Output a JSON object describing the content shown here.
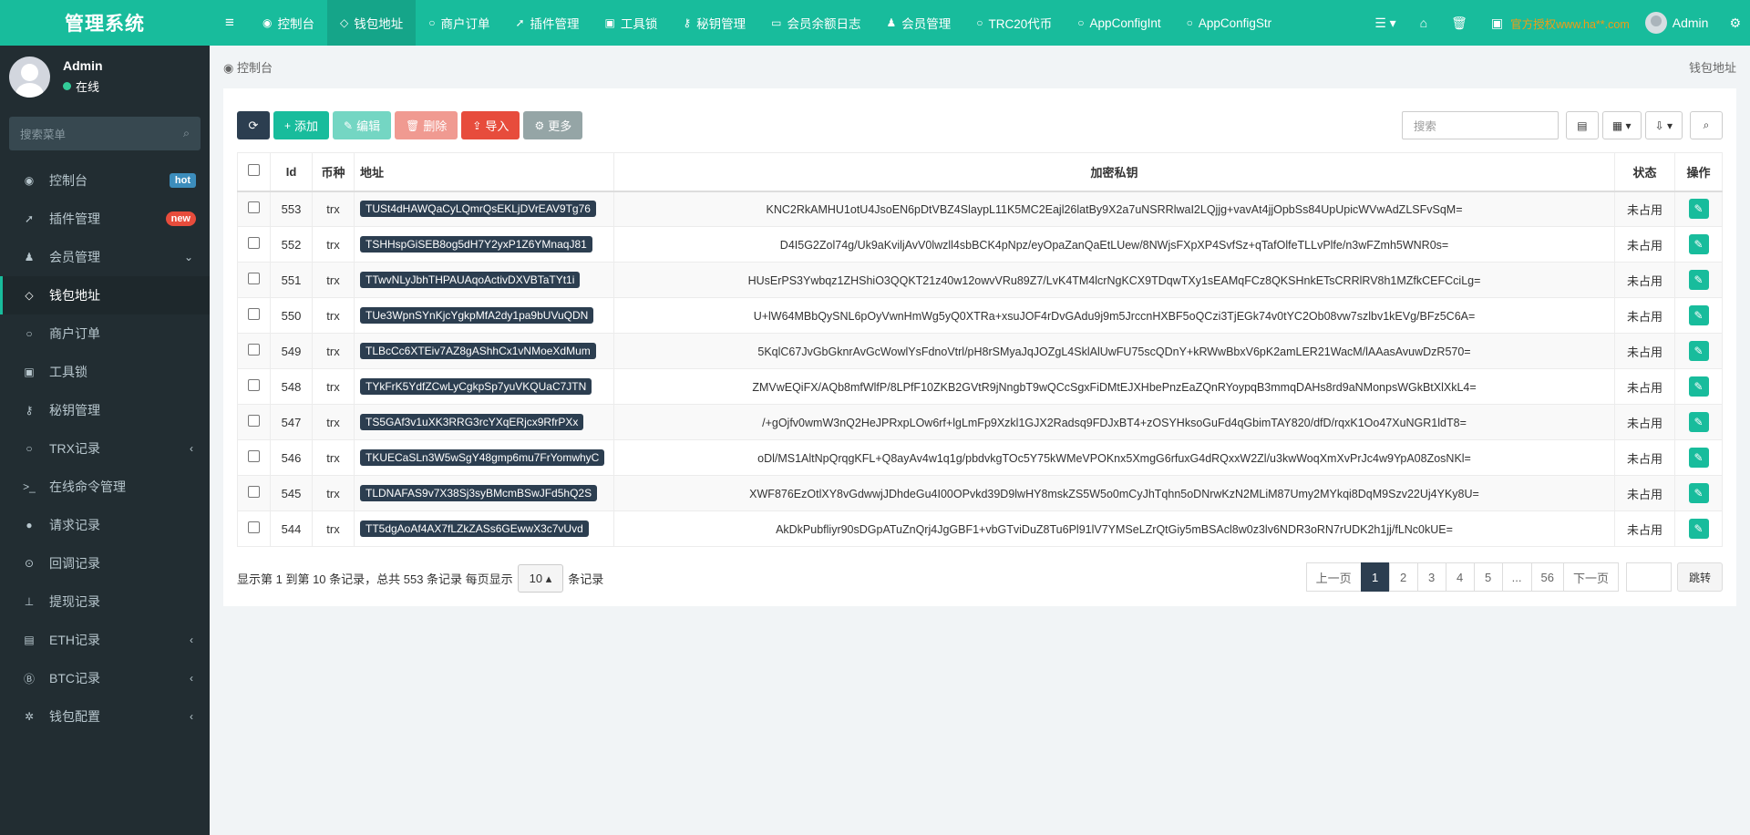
{
  "app": {
    "title": "管理系统"
  },
  "topnav": {
    "tabs": [
      {
        "icon": "dashboard-icon",
        "glyph": "◉",
        "label": "控制台"
      },
      {
        "icon": "diamond-icon",
        "glyph": "◇",
        "label": "钱包地址"
      },
      {
        "icon": "circle-icon",
        "glyph": "○",
        "label": "商户订单"
      },
      {
        "icon": "rocket-icon",
        "glyph": "➚",
        "label": "插件管理"
      },
      {
        "icon": "lock-icon",
        "glyph": "▣",
        "label": "工具锁"
      },
      {
        "icon": "key-icon",
        "glyph": "⚷",
        "label": "秘钥管理"
      },
      {
        "icon": "money-icon",
        "glyph": "▭",
        "label": "会员余额日志"
      },
      {
        "icon": "user-icon",
        "glyph": "♟",
        "label": "会员管理"
      },
      {
        "icon": "circle-icon",
        "glyph": "○",
        "label": "TRC20代币"
      },
      {
        "icon": "circle-icon",
        "glyph": "○",
        "label": "AppConfigInt"
      },
      {
        "icon": "circle-icon",
        "glyph": "○",
        "label": "AppConfigStr"
      }
    ],
    "right": {
      "promo": "官方授权www.ha**.com",
      "user": "Admin"
    }
  },
  "sidebar": {
    "user": {
      "name": "Admin",
      "status": "在线"
    },
    "search_placeholder": "搜索菜单",
    "items": [
      {
        "label": "控制台",
        "glyph": "◉",
        "badge": "hot"
      },
      {
        "label": "插件管理",
        "glyph": "➚",
        "badge": "new"
      },
      {
        "label": "会员管理",
        "glyph": "♟",
        "arrow": "⌄"
      },
      {
        "label": "钱包地址",
        "glyph": "◇"
      },
      {
        "label": "商户订单",
        "glyph": "○"
      },
      {
        "label": "工具锁",
        "glyph": "▣"
      },
      {
        "label": "秘钥管理",
        "glyph": "⚷"
      },
      {
        "label": "TRX记录",
        "glyph": "○",
        "arrow": "‹"
      },
      {
        "label": "在线命令管理",
        "glyph": ">_"
      },
      {
        "label": "请求记录",
        "glyph": "●"
      },
      {
        "label": "回调记录",
        "glyph": "⊙"
      },
      {
        "label": "提现记录",
        "glyph": "⊥"
      },
      {
        "label": "ETH记录",
        "glyph": "▤",
        "arrow": "‹"
      },
      {
        "label": "BTC记录",
        "glyph": "Ⓑ",
        "arrow": "‹"
      },
      {
        "label": "钱包配置",
        "glyph": "✲",
        "arrow": "‹"
      }
    ]
  },
  "breadcrumb": {
    "home": "控制台",
    "current": "钱包地址"
  },
  "toolbar": {
    "add": "添加",
    "edit": "编辑",
    "delete": "删除",
    "import": "导入",
    "more": "更多",
    "search_placeholder": "搜索"
  },
  "table": {
    "headers": {
      "id": "Id",
      "coin": "币种",
      "address": "地址",
      "key": "加密私钥",
      "status": "状态",
      "ops": "操作"
    },
    "rows": [
      {
        "id": "553",
        "coin": "trx",
        "address": "TUSt4dHAWQaCyLQmrQsEKLjDVrEAV9Tg76",
        "key": "KNC2RkAMHU1otU4JsoEN6pDtVBZ4SlaypL11K5MC2Eajl26latBy9X2a7uNSRRlwaI2LQjjg+vavAt4jjOpbSs84UpUpicWVwAdZLSFvSqM=",
        "status": "未占用"
      },
      {
        "id": "552",
        "coin": "trx",
        "address": "TSHHspGiSEB8og5dH7Y2yxP1Z6YMnaqJ81",
        "key": "D4I5G2Zol74g/Uk9aKviljAvV0lwzll4sbBCK4pNpz/eyOpaZanQaEtLUew/8NWjsFXpXP4SvfSz+qTafOlfeTLLvPlfe/n3wFZmh5WNR0s=",
        "status": "未占用"
      },
      {
        "id": "551",
        "coin": "trx",
        "address": "TTwvNLyJbhTHPAUAqoActivDXVBTaTYt1i",
        "key": "HUsErPS3Ywbqz1ZHShiO3QQKT21z40w12owvVRu89Z7/LvK4TM4lcrNgKCX9TDqwTXy1sEAMqFCz8QKSHnkETsCRRlRV8h1MZfkCEFCciLg=",
        "status": "未占用"
      },
      {
        "id": "550",
        "coin": "trx",
        "address": "TUe3WpnSYnKjcYgkpMfA2dy1pa9bUVuQDN",
        "key": "U+lW64MBbQySNL6pOyVwnHmWg5yQ0XTRa+xsuJOF4rDvGAdu9j9m5JrccnHXBF5oQCzi3TjEGk74v0tYC2Ob08vw7szlbv1kEVg/BFz5C6A=",
        "status": "未占用"
      },
      {
        "id": "549",
        "coin": "trx",
        "address": "TLBcCc6XTEiv7AZ8gAShhCx1vNMoeXdMum",
        "key": "5KqlC67JvGbGknrAvGcWowlYsFdnoVtrl/pH8rSMyaJqJOZgL4SklAlUwFU75scQDnY+kRWwBbxV6pK2amLER21WacM/lAAasAvuwDzR570=",
        "status": "未占用"
      },
      {
        "id": "548",
        "coin": "trx",
        "address": "TYkFrK5YdfZCwLyCgkpSp7yuVKQUaC7JTN",
        "key": "ZMVwEQiFX/AQb8mfWlfP/8LPfF10ZKB2GVtR9jNngbT9wQCcSgxFiDMtEJXHbePnzEaZQnRYoypqB3mmqDAHs8rd9aNMonpsWGkBtXlXkL4=",
        "status": "未占用"
      },
      {
        "id": "547",
        "coin": "trx",
        "address": "TS5GAf3v1uXK3RRG3rcYXqERjcx9RfrPXx",
        "key": "/+gOjfv0wmW3nQ2HeJPRxpLOw6rf+lgLmFp9Xzkl1GJX2Radsq9FDJxBT4+zOSYHksoGuFd4qGbimTAY820/dfD/rqxK1Oo47XuNGR1ldT8=",
        "status": "未占用"
      },
      {
        "id": "546",
        "coin": "trx",
        "address": "TKUECaSLn3W5wSgY48gmp6mu7FrYomwhyC",
        "key": "oDl/MS1AltNpQrqgKFL+Q8ayAv4w1q1g/pbdvkgTOc5Y75kWMeVPOKnx5XmgG6rfuxG4dRQxxW2Zl/u3kwWoqXmXvPrJc4w9YpA08ZosNKl=",
        "status": "未占用"
      },
      {
        "id": "545",
        "coin": "trx",
        "address": "TLDNAFAS9v7X38Sj3syBMcmBSwJFd5hQ2S",
        "key": "XWF876EzOtlXY8vGdwwjJDhdeGu4I00OPvkd39D9lwHY8mskZS5W5o0mCyJhTqhn5oDNrwKzN2MLiM87Umy2MYkqi8DqM9Szv22Uj4YKy8U=",
        "status": "未占用"
      },
      {
        "id": "544",
        "coin": "trx",
        "address": "TT5dgAoAf4AX7fLZkZASs6GEwwX3c7vUvd",
        "key": "AkDkPubfliyr90sDGpATuZnQrj4JgGBF1+vbGTviDuZ8Tu6Pl91lV7YMSeLZrQtGiy5mBSAcl8w0z3lv6NDR3oRN7rUDK2h1jj/fLNc0kUE=",
        "status": "未占用"
      }
    ]
  },
  "pagination": {
    "info_prefix": "显示第 1 到第 10 条记录，总共 553 条记录 每页显示",
    "page_size": "10",
    "info_suffix": "条记录",
    "prev": "上一页",
    "pages": [
      "1",
      "2",
      "3",
      "4",
      "5",
      "...",
      "56"
    ],
    "active_page": "1",
    "next": "下一页",
    "jump": "跳转"
  },
  "colors": {
    "brand": "#18bc9c",
    "sidebar": "#222d32",
    "dark": "#2c3e50",
    "danger": "#e74c3c"
  }
}
